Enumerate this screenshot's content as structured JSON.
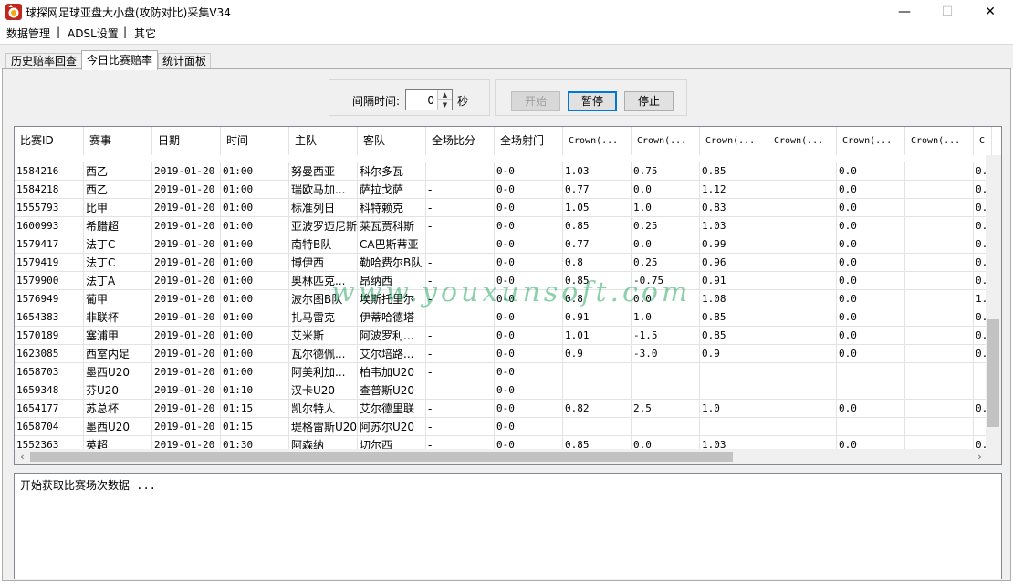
{
  "window": {
    "title": "球探网足球亚盘大小盘(攻防对比)采集V34"
  },
  "menu": {
    "items": [
      "数据管理",
      "ADSL设置",
      "其它"
    ],
    "separator": "|"
  },
  "tabs": [
    {
      "label": "历史赔率回查"
    },
    {
      "label": "今日比赛赔率"
    },
    {
      "label": "统计面板"
    }
  ],
  "controls": {
    "interval_label": "间隔时间:",
    "interval_value": "0",
    "seconds_label": "秒",
    "start_label": "开始",
    "pause_label": "暂停",
    "stop_label": "停止"
  },
  "table": {
    "columns": [
      "比赛ID",
      "赛事",
      "日期",
      "时间",
      "主队",
      "客队",
      "全场比分",
      "全场射门",
      "Crown(...",
      "Crown(...",
      "Crown(...",
      "Crown(...",
      "Crown(...",
      "Crown(...",
      "C"
    ],
    "rows": [
      [
        "1584216",
        "西乙",
        "2019-01-20",
        "01:00",
        "努曼西亚",
        "科尔多瓦",
        "-",
        "0-0",
        "1.03",
        "0.75",
        "0.85",
        "",
        "0.0",
        "",
        "0."
      ],
      [
        "1584218",
        "西乙",
        "2019-01-20",
        "01:00",
        "瑞欧马加...",
        "萨拉戈萨",
        "-",
        "0-0",
        "0.77",
        "0.0",
        "1.12",
        "",
        "0.0",
        "",
        "0."
      ],
      [
        "1555793",
        "比甲",
        "2019-01-20",
        "01:00",
        "标准列日",
        "科特赖克",
        "-",
        "0-0",
        "1.05",
        "1.0",
        "0.83",
        "",
        "0.0",
        "",
        "0."
      ],
      [
        "1600993",
        "希腊超",
        "2019-01-20",
        "01:00",
        "亚波罗迈尼斯",
        "莱瓦贾科斯",
        "-",
        "0-0",
        "0.85",
        "0.25",
        "1.03",
        "",
        "0.0",
        "",
        "0."
      ],
      [
        "1579417",
        "法丁C",
        "2019-01-20",
        "01:00",
        "南特B队",
        "CA巴斯蒂亚",
        "-",
        "0-0",
        "0.77",
        "0.0",
        "0.99",
        "",
        "0.0",
        "",
        "0."
      ],
      [
        "1579419",
        "法丁C",
        "2019-01-20",
        "01:00",
        "博伊西",
        "勒哈费尔B队",
        "-",
        "0-0",
        "0.8",
        "0.25",
        "0.96",
        "",
        "0.0",
        "",
        "0."
      ],
      [
        "1579900",
        "法丁A",
        "2019-01-20",
        "01:00",
        "奥林匹克...",
        "昂纳西",
        "-",
        "0-0",
        "0.85",
        "-0.75",
        "0.91",
        "",
        "0.0",
        "",
        "0."
      ],
      [
        "1576949",
        "葡甲",
        "2019-01-20",
        "01:00",
        "波尔图B队",
        "埃斯托里尔",
        "-",
        "0-0",
        "0.8",
        "0.0",
        "1.08",
        "",
        "0.0",
        "",
        "1."
      ],
      [
        "1654383",
        "非联杯",
        "2019-01-20",
        "01:00",
        "扎马雷克",
        "伊蒂哈德塔",
        "-",
        "0-0",
        "0.91",
        "1.0",
        "0.85",
        "",
        "0.0",
        "",
        "0."
      ],
      [
        "1570189",
        "塞浦甲",
        "2019-01-20",
        "01:00",
        "艾米斯",
        "阿波罗利...",
        "-",
        "0-0",
        "1.01",
        "-1.5",
        "0.85",
        "",
        "0.0",
        "",
        "0."
      ],
      [
        "1623085",
        "西室内足",
        "2019-01-20",
        "01:00",
        "瓦尔德佩...",
        "艾尔培路...",
        "-",
        "0-0",
        "0.9",
        "-3.0",
        "0.9",
        "",
        "0.0",
        "",
        "0."
      ],
      [
        "1658703",
        "墨西U20",
        "2019-01-20",
        "01:00",
        "阿美利加...",
        "柏韦加U20",
        "-",
        "0-0",
        "",
        "",
        "",
        "",
        "",
        "",
        ""
      ],
      [
        "1659348",
        "芬U20",
        "2019-01-20",
        "01:10",
        "汉卡U20",
        "查普斯U20",
        "-",
        "0-0",
        "",
        "",
        "",
        "",
        "",
        "",
        ""
      ],
      [
        "1654177",
        "苏总杯",
        "2019-01-20",
        "01:15",
        "凯尔特人",
        "艾尔德里联",
        "-",
        "0-0",
        "0.82",
        "2.5",
        "1.0",
        "",
        "0.0",
        "",
        "0."
      ],
      [
        "1658704",
        "墨西U20",
        "2019-01-20",
        "01:15",
        "堤格雷斯U20",
        "阿苏尔U20",
        "-",
        "0-0",
        "",
        "",
        "",
        "",
        "",
        "",
        ""
      ],
      [
        "1552363",
        "英超",
        "2019-01-20",
        "01:30",
        "阿森纳",
        "切尔西",
        "-",
        "0-0",
        "0.85",
        "0.0",
        "1.03",
        "",
        "0.0",
        "",
        "0."
      ]
    ]
  },
  "log": {
    "text": "开始获取比赛场次数据 ..."
  },
  "watermark": {
    "text": "www.youxunsoft.com"
  }
}
